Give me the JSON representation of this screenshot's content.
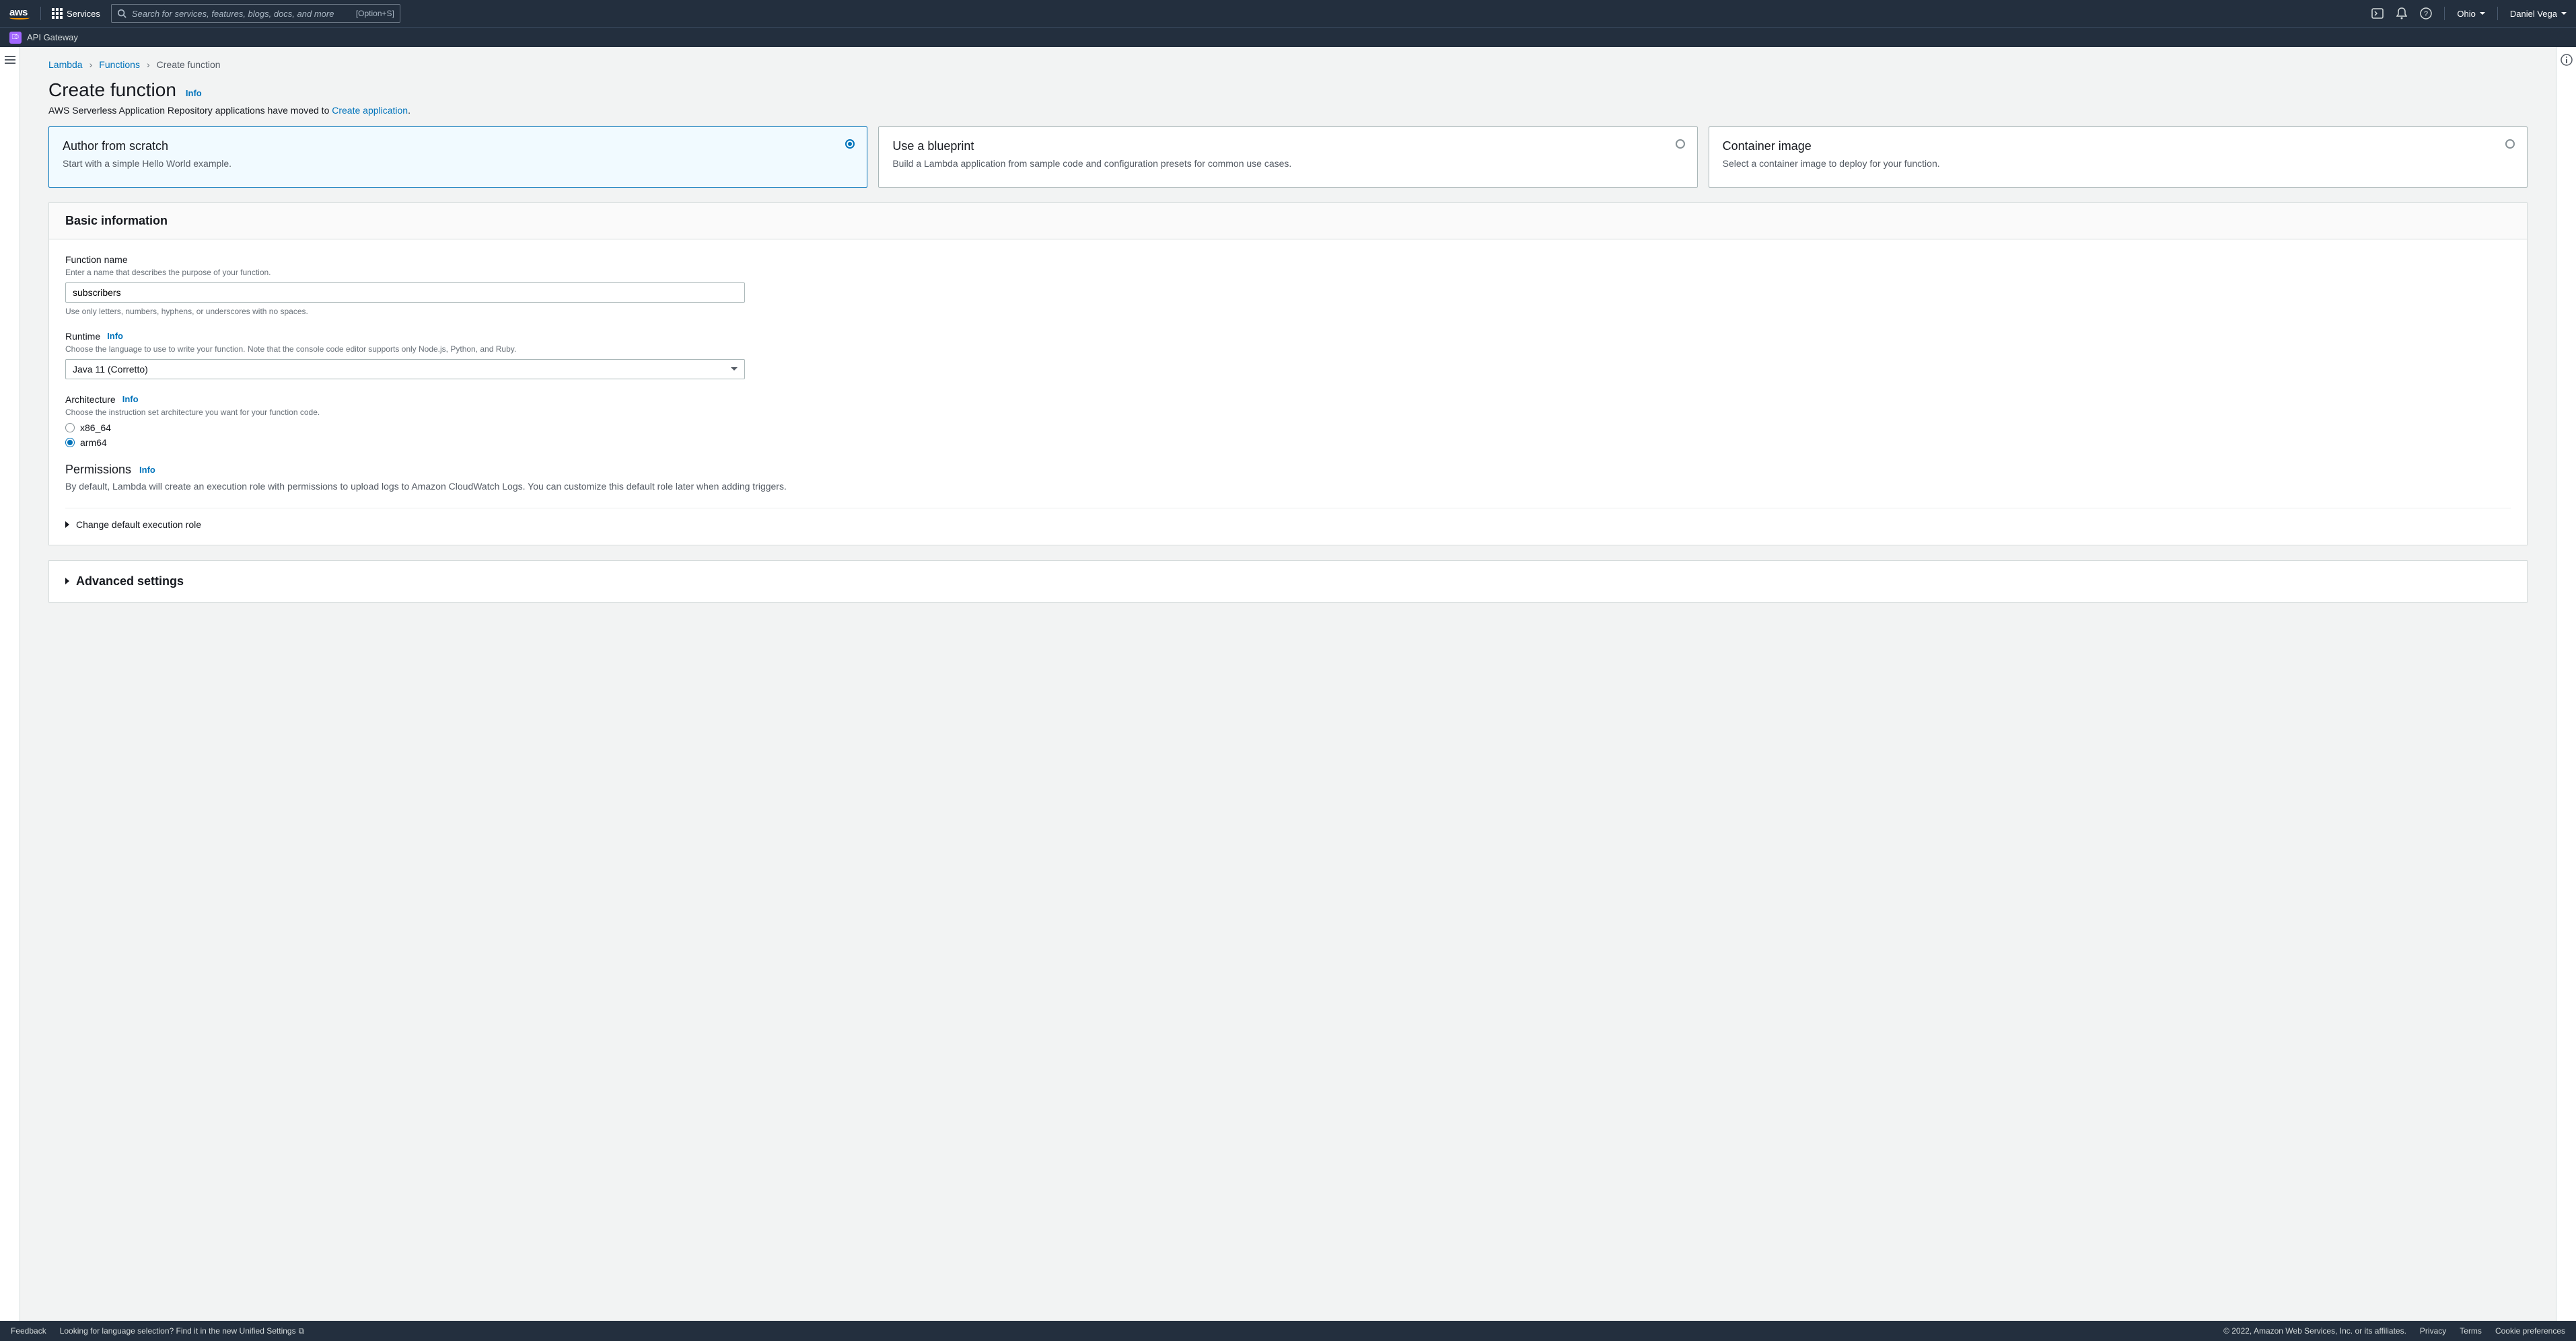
{
  "topnav": {
    "logo_text": "aws",
    "services_label": "Services",
    "search_placeholder": "Search for services, features, blogs, docs, and more",
    "search_shortcut": "[Option+S]",
    "region": "Ohio",
    "user": "Daniel Vega"
  },
  "secondbar": {
    "service": "API Gateway"
  },
  "breadcrumb": {
    "items": [
      "Lambda",
      "Functions"
    ],
    "current": "Create function"
  },
  "page": {
    "title": "Create function",
    "info": "Info",
    "subhead_prefix": "AWS Serverless Application Repository applications have moved to ",
    "subhead_link": "Create application",
    "subhead_suffix": "."
  },
  "options": [
    {
      "title": "Author from scratch",
      "desc": "Start with a simple Hello World example.",
      "selected": true
    },
    {
      "title": "Use a blueprint",
      "desc": "Build a Lambda application from sample code and configuration presets for common use cases.",
      "selected": false
    },
    {
      "title": "Container image",
      "desc": "Select a container image to deploy for your function.",
      "selected": false
    }
  ],
  "basic": {
    "header": "Basic information",
    "fn_name_label": "Function name",
    "fn_name_hint": "Enter a name that describes the purpose of your function.",
    "fn_name_value": "subscribers",
    "fn_name_note": "Use only letters, numbers, hyphens, or underscores with no spaces.",
    "runtime_label": "Runtime",
    "runtime_info": "Info",
    "runtime_hint": "Choose the language to use to write your function. Note that the console code editor supports only Node.js, Python, and Ruby.",
    "runtime_value": "Java 11 (Corretto)",
    "arch_label": "Architecture",
    "arch_info": "Info",
    "arch_hint": "Choose the instruction set architecture you want for your function code.",
    "arch_options": [
      "x86_64",
      "arm64"
    ],
    "arch_selected": "arm64",
    "perm_label": "Permissions",
    "perm_info": "Info",
    "perm_desc": "By default, Lambda will create an execution role with permissions to upload logs to Amazon CloudWatch Logs. You can customize this default role later when adding triggers.",
    "exec_role_label": "Change default execution role"
  },
  "advanced": {
    "label": "Advanced settings"
  },
  "footer": {
    "feedback": "Feedback",
    "lang_prefix": "Looking for language selection? Find it in the new ",
    "lang_link": "Unified Settings",
    "copyright": "© 2022, Amazon Web Services, Inc. or its affiliates.",
    "privacy": "Privacy",
    "terms": "Terms",
    "cookies": "Cookie preferences"
  }
}
